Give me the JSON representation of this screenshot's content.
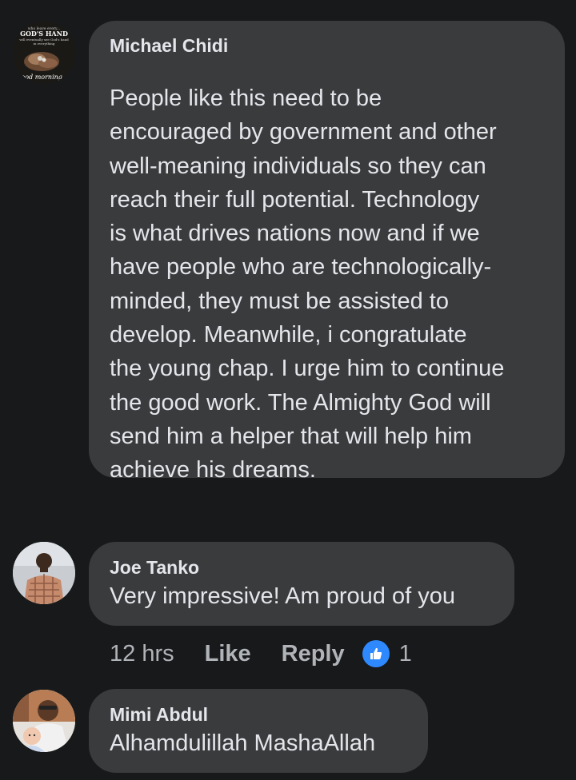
{
  "comments": [
    {
      "author": "Michael Chidi",
      "avatar_text": {
        "line1": "who leave every...",
        "line2": "GOD'S HAND",
        "line3": "will eventually see God's hand",
        "line4": "in everything",
        "line5": "Good morning"
      },
      "lines": [
        "People like this need to be",
        "encouraged by government and other",
        "well-meaning individuals so they can",
        "reach their full potential. Technology",
        "is what drives nations now and if we",
        "have people who are technologically-",
        "minded, they must be assisted to",
        "develop. Meanwhile, i congratulate",
        "the young chap. I urge him to continue",
        "the good work. The Almighty God will",
        "send him a helper that will help him",
        "achieve his dreams."
      ]
    },
    {
      "author": "Joe Tanko",
      "text": "Very impressive! Am proud of you",
      "meta": {
        "time": "12 hrs",
        "like_label": "Like",
        "reply_label": "Reply",
        "reaction_icon": "thumbs-up-icon",
        "reaction_count": "1"
      }
    },
    {
      "author": "Mimi Abdul",
      "text": "Alhamdulillah MashaAllah"
    }
  ],
  "colors": {
    "background": "#18191a",
    "bubble": "#3a3b3c",
    "text": "#e4e6eb",
    "secondary_text": "#b0b3b8",
    "reaction_blue": "#2e89ff"
  }
}
